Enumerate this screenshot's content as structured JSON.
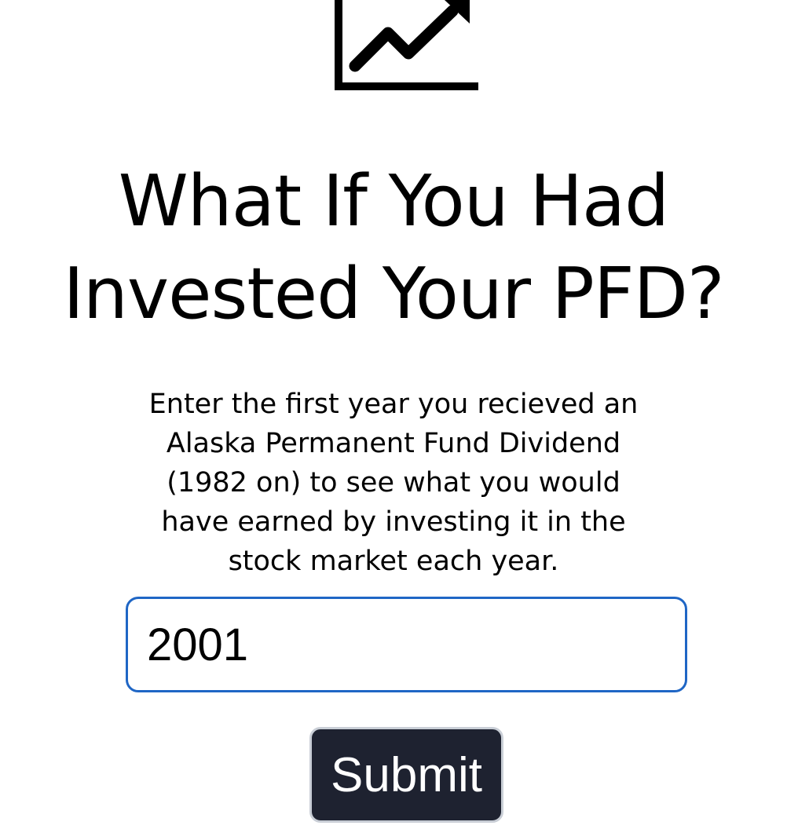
{
  "logo": {
    "icon": "chart-trending-up-icon"
  },
  "header": {
    "title_line1": "What If You Had",
    "title_line2": "Invested Your PFD?"
  },
  "intro": {
    "line1": "Enter the first year you recieved an",
    "line2": "Alaska Permanent Fund Dividend",
    "line3": "(1982 on) to see what you would",
    "line4": "have earned by investing it in the",
    "line5": "stock market each year."
  },
  "form": {
    "year_value": "2001",
    "submit_label": "Submit"
  },
  "colors": {
    "input_border": "#1f66c5",
    "button_background": "#1e2230",
    "button_text": "#ffffff"
  }
}
